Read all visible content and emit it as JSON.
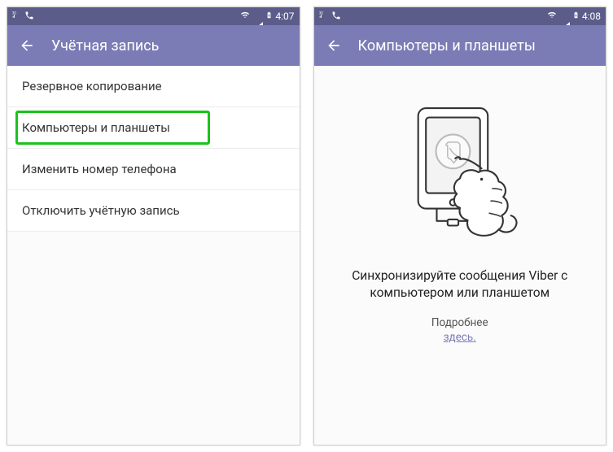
{
  "colors": {
    "accent": "#7b7cb5",
    "statusBg": "#5c5c8a",
    "highlight": "#1bc21b",
    "link": "#7b7cb5"
  },
  "left": {
    "statusbar": {
      "time": "4:07",
      "icons": [
        "signal-3g-icon",
        "phone-call-icon",
        "wifi-icon",
        "cell-signal-icon",
        "battery-charging-icon"
      ]
    },
    "header": {
      "title": "Учётная запись"
    },
    "menu": {
      "items": [
        {
          "label": "Резервное копирование",
          "highlighted": false
        },
        {
          "label": "Компьютеры и планшеты",
          "highlighted": true
        },
        {
          "label": "Изменить номер телефона",
          "highlighted": false
        },
        {
          "label": "Отключить учётную запись",
          "highlighted": false
        }
      ]
    }
  },
  "right": {
    "statusbar": {
      "time": "4:08",
      "icons": [
        "signal-3g-icon",
        "phone-call-icon",
        "wifi-icon",
        "cell-signal-icon",
        "battery-charging-icon"
      ]
    },
    "header": {
      "title": "Компьютеры и планшеты"
    },
    "sync": {
      "title": "Синхронизируйте сообщения Viber с компьютером или планшетом",
      "more_label": "Подробнее",
      "link_label": "здесь."
    }
  }
}
